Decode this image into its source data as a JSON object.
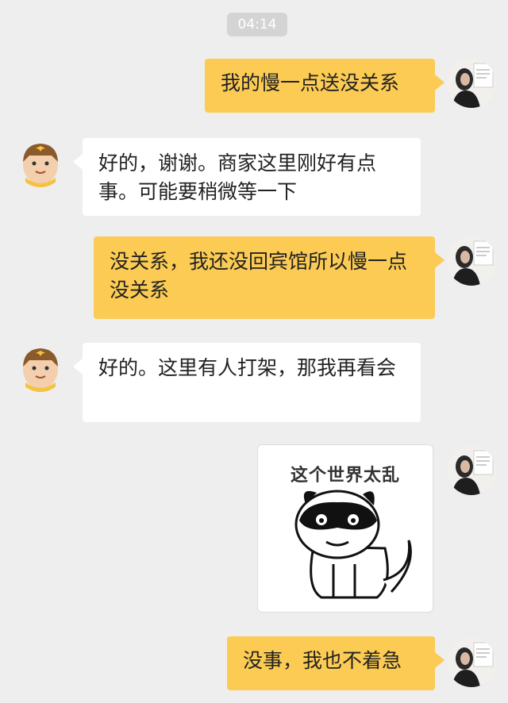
{
  "timestamp": "04:14",
  "messages": [
    {
      "side": "out",
      "text": "我的慢一点送没关系"
    },
    {
      "side": "in",
      "text": "好的，谢谢。商家这里刚好有点事。可能要稍微等一下"
    },
    {
      "side": "out",
      "text": "没关系，我还没回宾馆所以慢一点没关系"
    },
    {
      "side": "in",
      "text": "好的。这里有人打架，那我再看会"
    },
    {
      "side": "out",
      "type": "sticker",
      "caption": "这个世界太乱"
    },
    {
      "side": "out",
      "text": "没事，我也不着急"
    }
  ],
  "colors": {
    "outgoing_bubble": "#fbcb53",
    "incoming_bubble": "#ffffff",
    "background": "#eeeeee"
  },
  "icons": {
    "courier_avatar": "courier-avatar-icon",
    "user_avatar": "user-avatar-photo"
  }
}
